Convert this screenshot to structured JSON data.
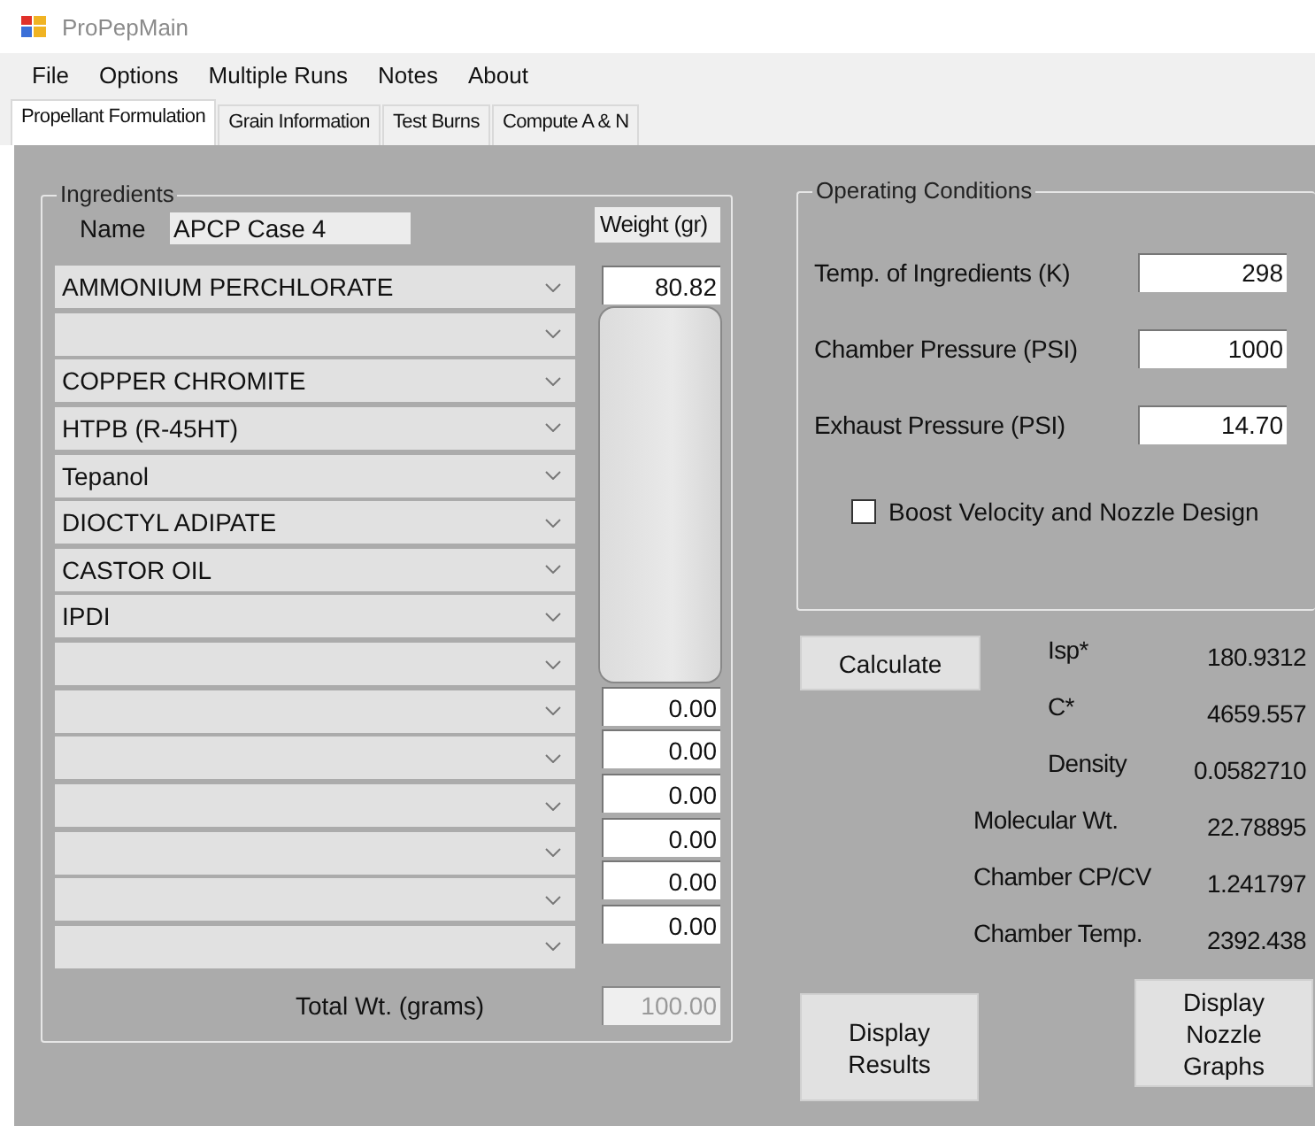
{
  "window": {
    "title": "ProPepMain"
  },
  "menu": [
    "File",
    "Options",
    "Multiple Runs",
    "Notes",
    "About"
  ],
  "tabs": [
    {
      "label": "Propellant Formulation",
      "selected": true
    },
    {
      "label": "Grain Information",
      "selected": false
    },
    {
      "label": "Test Burns",
      "selected": false
    },
    {
      "label": "Compute A & N",
      "selected": false
    }
  ],
  "ingredients": {
    "title": "Ingredients",
    "name_label": "Name",
    "name_value": "APCP Case 4",
    "weight_header": "Weight (gr)",
    "rows": [
      {
        "name": "AMMONIUM PERCHLORATE",
        "weight": "80.82"
      },
      {
        "name": ""
      },
      {
        "name": "COPPER CHROMITE"
      },
      {
        "name": "HTPB (R-45HT)"
      },
      {
        "name": "Tepanol"
      },
      {
        "name": "DIOCTYL ADIPATE"
      },
      {
        "name": "CASTOR OIL"
      },
      {
        "name": "IPDI"
      },
      {
        "name": ""
      },
      {
        "name": "",
        "weight": "0.00"
      },
      {
        "name": "",
        "weight": "0.00"
      },
      {
        "name": "",
        "weight": "0.00"
      },
      {
        "name": "",
        "weight": "0.00"
      },
      {
        "name": "",
        "weight": "0.00"
      },
      {
        "name": "",
        "weight": "0.00"
      }
    ],
    "total_label": "Total Wt. (grams)",
    "total_value": "100.00"
  },
  "operating_conditions": {
    "title": "Operating Conditions",
    "fields": [
      {
        "label": "Temp. of Ingredients (K)",
        "value": "298"
      },
      {
        "label": "Chamber Pressure (PSI)",
        "value": "1000"
      },
      {
        "label": "Exhaust Pressure (PSI)",
        "value": "14.70"
      }
    ],
    "checkbox": {
      "label": "Boost Velocity and Nozzle Design",
      "checked": false
    }
  },
  "calculate_button": "Calculate",
  "results": [
    {
      "label": "Isp*",
      "value": "180.9312"
    },
    {
      "label": "C*",
      "value": "4659.557"
    },
    {
      "label": "Density",
      "value": "0.0582710"
    },
    {
      "label": "Molecular Wt.",
      "value": "22.78895"
    },
    {
      "label": "Chamber CP/CV",
      "value": "1.241797"
    },
    {
      "label": "Chamber Temp.",
      "value": "2392.438"
    }
  ],
  "buttons": [
    "Display\nResults",
    "Display\nNozzle\nGraphs"
  ]
}
